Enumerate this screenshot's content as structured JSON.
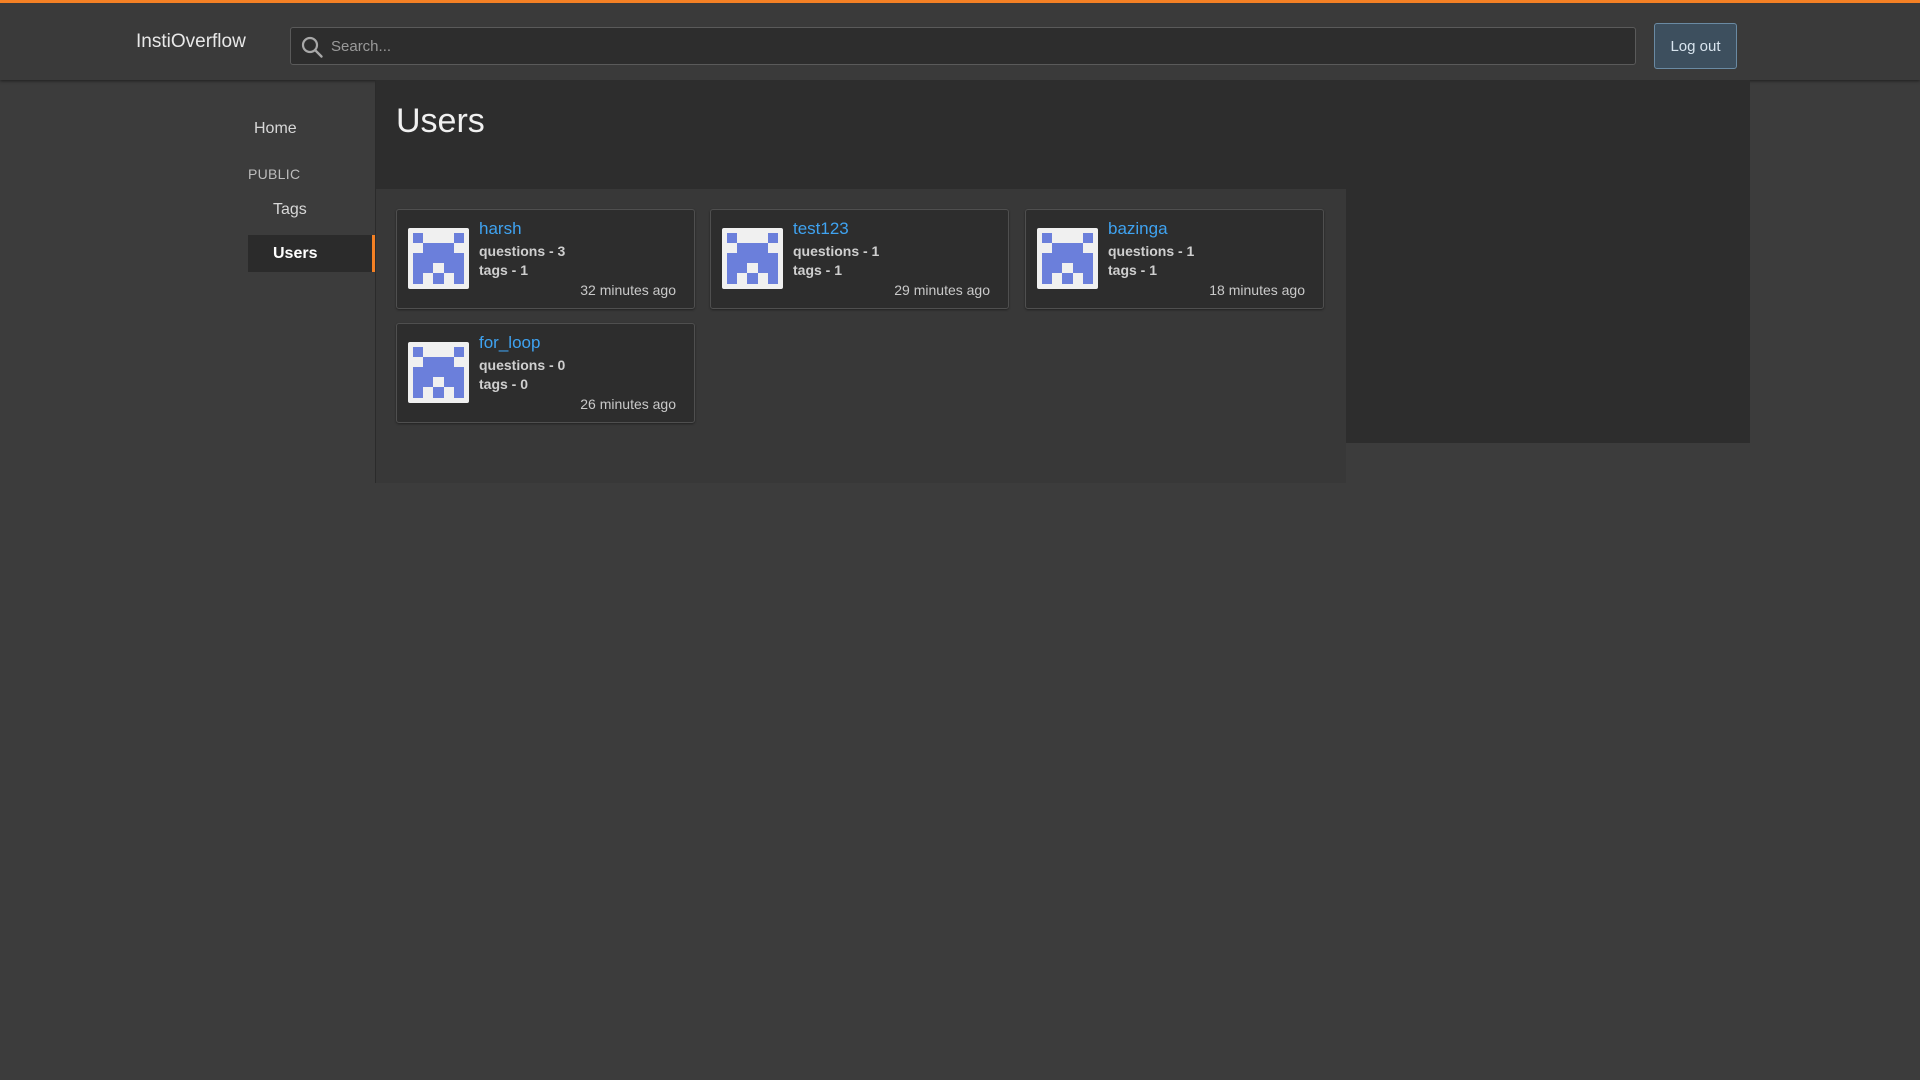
{
  "header": {
    "logo": "InstiOverflow",
    "search_placeholder": "Search...",
    "logout_label": "Log out"
  },
  "sidebar": {
    "home": "Home",
    "section": "PUBLIC",
    "tags": "Tags",
    "users": "Users"
  },
  "page": {
    "title": "Users"
  },
  "users": [
    {
      "name": "harsh",
      "questions": "questions - 3",
      "tags": "tags - 1",
      "time": "32 minutes ago"
    },
    {
      "name": "test123",
      "questions": "questions - 1",
      "tags": "tags - 1",
      "time": "29 minutes ago"
    },
    {
      "name": "bazinga",
      "questions": "questions - 1",
      "tags": "tags - 1",
      "time": "18 minutes ago"
    },
    {
      "name": "for_loop",
      "questions": "questions - 0",
      "tags": "tags - 0",
      "time": "26 minutes ago"
    }
  ],
  "colors": {
    "accent": "#f48024",
    "link": "#3fa3f1",
    "avatar": "#6b7fdb"
  },
  "icons": {
    "search": "search-icon",
    "avatar": "identicon-avatar"
  }
}
